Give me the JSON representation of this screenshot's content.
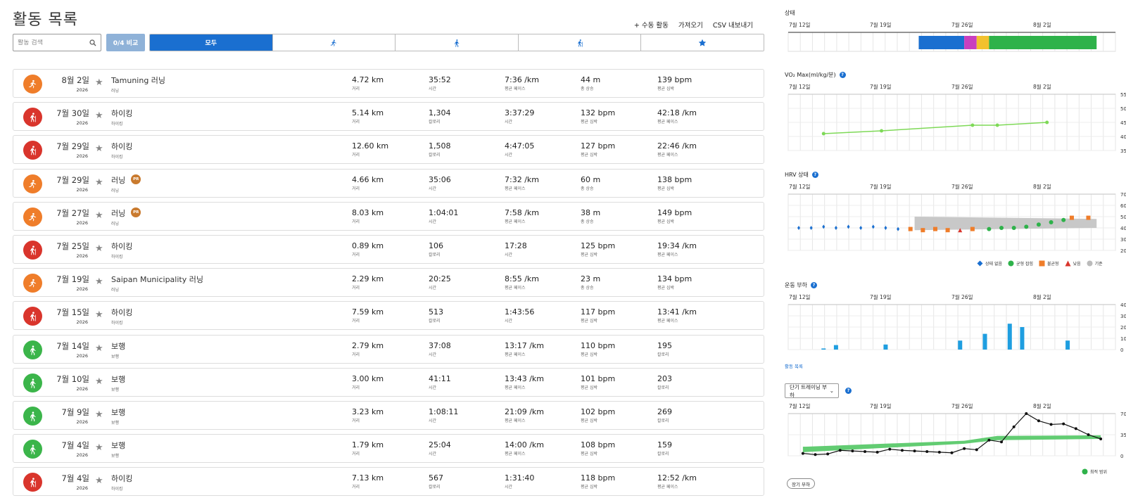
{
  "page": {
    "title": "활동 목록",
    "actions": [
      "+ 수동 활동",
      "가져오기",
      "CSV 내보내기"
    ],
    "search_placeholder": "활동 검색",
    "compare_label": "0/4 비교",
    "tabs": [
      {
        "label": "모두",
        "icon": "all",
        "active": true
      },
      {
        "label": "",
        "icon": "running-icon",
        "active": false
      },
      {
        "label": "",
        "icon": "walking-icon",
        "active": false
      },
      {
        "label": "",
        "icon": "hiking-icon",
        "active": false
      },
      {
        "label": "",
        "icon": "star-icon",
        "active": false
      }
    ]
  },
  "activities": [
    {
      "type": "running",
      "color": "#ef7d2a",
      "date": "8월 2일",
      "year": "2026",
      "name": "Tamuning 러닝",
      "sub": "러닝",
      "badge": false,
      "metrics": [
        {
          "v": "4.72 km",
          "l": "거리"
        },
        {
          "v": "35:52",
          "l": "시간"
        },
        {
          "v": "7:36 /km",
          "l": "평균 페이스"
        },
        {
          "v": "44 m",
          "l": "총 상승"
        },
        {
          "v": "139 bpm",
          "l": "평균 심박"
        }
      ]
    },
    {
      "type": "hiking",
      "color": "#d9352c",
      "date": "7월 30일",
      "year": "2026",
      "name": "하이킹",
      "sub": "하이킹",
      "badge": false,
      "metrics": [
        {
          "v": "5.14 km",
          "l": "거리"
        },
        {
          "v": "1,304",
          "l": "칼로리"
        },
        {
          "v": "3:37:29",
          "l": "시간"
        },
        {
          "v": "132 bpm",
          "l": "평균 심박"
        },
        {
          "v": "42:18 /km",
          "l": "평균 페이스"
        }
      ]
    },
    {
      "type": "hiking",
      "color": "#d9352c",
      "date": "7월 29일",
      "year": "2026",
      "name": "하이킹",
      "sub": "하이킹",
      "badge": false,
      "metrics": [
        {
          "v": "12.60 km",
          "l": "거리"
        },
        {
          "v": "1,508",
          "l": "칼로리"
        },
        {
          "v": "4:47:05",
          "l": "시간"
        },
        {
          "v": "127 bpm",
          "l": "평균 심박"
        },
        {
          "v": "22:46 /km",
          "l": "평균 페이스"
        }
      ]
    },
    {
      "type": "running",
      "color": "#ef7d2a",
      "date": "7월 29일",
      "year": "2026",
      "name": "러닝",
      "sub": "러닝",
      "badge": true,
      "metrics": [
        {
          "v": "4.66 km",
          "l": "거리"
        },
        {
          "v": "35:06",
          "l": "시간"
        },
        {
          "v": "7:32 /km",
          "l": "평균 페이스"
        },
        {
          "v": "60 m",
          "l": "총 상승"
        },
        {
          "v": "138 bpm",
          "l": "평균 심박"
        }
      ]
    },
    {
      "type": "running",
      "color": "#ef7d2a",
      "date": "7월 27일",
      "year": "2026",
      "name": "러닝",
      "sub": "러닝",
      "badge": true,
      "metrics": [
        {
          "v": "8.03 km",
          "l": "거리"
        },
        {
          "v": "1:04:01",
          "l": "시간"
        },
        {
          "v": "7:58 /km",
          "l": "평균 페이스"
        },
        {
          "v": "38 m",
          "l": "총 상승"
        },
        {
          "v": "149 bpm",
          "l": "평균 심박"
        }
      ]
    },
    {
      "type": "hiking",
      "color": "#d9352c",
      "date": "7월 25일",
      "year": "2026",
      "name": "하이킹",
      "sub": "하이킹",
      "badge": false,
      "metrics": [
        {
          "v": "0.89 km",
          "l": "거리"
        },
        {
          "v": "106",
          "l": "칼로리"
        },
        {
          "v": "17:28",
          "l": "시간"
        },
        {
          "v": "125 bpm",
          "l": "평균 심박"
        },
        {
          "v": "19:34 /km",
          "l": "평균 페이스"
        }
      ]
    },
    {
      "type": "running",
      "color": "#ef7d2a",
      "date": "7월 19일",
      "year": "2026",
      "name": "Saipan Municipality 러닝",
      "sub": "러닝",
      "badge": false,
      "metrics": [
        {
          "v": "2.29 km",
          "l": "거리"
        },
        {
          "v": "20:25",
          "l": "시간"
        },
        {
          "v": "8:55 /km",
          "l": "평균 페이스"
        },
        {
          "v": "23 m",
          "l": "총 상승"
        },
        {
          "v": "134 bpm",
          "l": "평균 심박"
        }
      ]
    },
    {
      "type": "hiking",
      "color": "#d9352c",
      "date": "7월 15일",
      "year": "2026",
      "name": "하이킹",
      "sub": "하이킹",
      "badge": false,
      "metrics": [
        {
          "v": "7.59 km",
          "l": "거리"
        },
        {
          "v": "513",
          "l": "칼로리"
        },
        {
          "v": "1:43:56",
          "l": "시간"
        },
        {
          "v": "117 bpm",
          "l": "평균 심박"
        },
        {
          "v": "13:41 /km",
          "l": "평균 페이스"
        }
      ]
    },
    {
      "type": "walking",
      "color": "#3bb54a",
      "date": "7월 14일",
      "year": "2026",
      "name": "보행",
      "sub": "보행",
      "badge": false,
      "metrics": [
        {
          "v": "2.79 km",
          "l": "거리"
        },
        {
          "v": "37:08",
          "l": "시간"
        },
        {
          "v": "13:17 /km",
          "l": "평균 페이스"
        },
        {
          "v": "110 bpm",
          "l": "평균 심박"
        },
        {
          "v": "195",
          "l": "칼로리"
        }
      ]
    },
    {
      "type": "walking",
      "color": "#3bb54a",
      "date": "7월 10일",
      "year": "2026",
      "name": "보행",
      "sub": "보행",
      "badge": false,
      "metrics": [
        {
          "v": "3.00 km",
          "l": "거리"
        },
        {
          "v": "41:11",
          "l": "시간"
        },
        {
          "v": "13:43 /km",
          "l": "평균 페이스"
        },
        {
          "v": "101 bpm",
          "l": "평균 심박"
        },
        {
          "v": "203",
          "l": "칼로리"
        }
      ]
    },
    {
      "type": "walking",
      "color": "#3bb54a",
      "date": "7월 9일",
      "year": "2026",
      "name": "보행",
      "sub": "보행",
      "badge": false,
      "metrics": [
        {
          "v": "3.23 km",
          "l": "거리"
        },
        {
          "v": "1:08:11",
          "l": "시간"
        },
        {
          "v": "21:09 /km",
          "l": "평균 페이스"
        },
        {
          "v": "102 bpm",
          "l": "평균 심박"
        },
        {
          "v": "269",
          "l": "칼로리"
        }
      ]
    },
    {
      "type": "walking",
      "color": "#3bb54a",
      "date": "7월 4일",
      "year": "2026",
      "name": "보행",
      "sub": "보행",
      "badge": false,
      "metrics": [
        {
          "v": "1.79 km",
          "l": "거리"
        },
        {
          "v": "25:04",
          "l": "시간"
        },
        {
          "v": "14:00 /km",
          "l": "평균 페이스"
        },
        {
          "v": "108 bpm",
          "l": "평균 심박"
        },
        {
          "v": "159",
          "l": "칼로리"
        }
      ]
    },
    {
      "type": "hiking",
      "color": "#d9352c",
      "date": "7월 4일",
      "year": "2026",
      "name": "하이킹",
      "sub": "하이킹",
      "badge": false,
      "metrics": [
        {
          "v": "7.13 km",
          "l": "거리"
        },
        {
          "v": "567",
          "l": "칼로리"
        },
        {
          "v": "1:31:40",
          "l": "시간"
        },
        {
          "v": "118 bpm",
          "l": "평균 심박"
        },
        {
          "v": "12:52 /km",
          "l": "평균 페이스"
        }
      ]
    }
  ],
  "right": {
    "date_labels": [
      "7월 12일",
      "7월 19일",
      "7월 26일",
      "8월 2일"
    ],
    "status": {
      "title": "상태",
      "segments": [
        {
          "from": 14.5,
          "to": 20,
          "color": "#1a6fd0"
        },
        {
          "from": 20,
          "to": 21.5,
          "color": "#c93fbf"
        },
        {
          "from": 21.5,
          "to": 23,
          "color": "#f2c12e"
        },
        {
          "from": 23,
          "to": 36,
          "color": "#2eb24a"
        }
      ]
    },
    "vo2": {
      "title": "VO₂ Max(ml/kg/분)",
      "yticks": [
        55,
        50,
        45,
        40,
        35
      ],
      "ylim": [
        35,
        55
      ],
      "points": [
        [
          3,
          41
        ],
        [
          10,
          42
        ],
        [
          21,
          44
        ],
        [
          24,
          44
        ],
        [
          30,
          45
        ]
      ],
      "color": "#7ed957"
    },
    "hrv": {
      "title": "HRV 상태",
      "yticks": [
        70,
        60,
        50,
        40,
        30,
        20
      ],
      "ylim": [
        20,
        70
      ],
      "band": {
        "from": 14,
        "to": 36,
        "low": [
          38,
          40
        ],
        "high": [
          50,
          48
        ]
      },
      "none": [
        [
          0,
          40
        ],
        [
          1.5,
          40
        ],
        [
          3,
          41
        ],
        [
          4.5,
          40
        ],
        [
          6,
          41
        ],
        [
          7.5,
          40
        ],
        [
          9,
          41
        ],
        [
          10.5,
          40
        ],
        [
          12,
          39
        ]
      ],
      "unbalanced": [
        [
          13.5,
          39
        ],
        [
          15,
          38
        ],
        [
          16.5,
          39
        ],
        [
          18,
          38
        ],
        [
          21,
          39
        ],
        [
          33,
          49
        ],
        [
          35,
          49
        ]
      ],
      "low": [
        [
          19.5,
          38
        ]
      ],
      "balanced": [
        [
          23,
          39
        ],
        [
          24.5,
          40
        ],
        [
          26,
          40
        ],
        [
          27.5,
          41
        ],
        [
          29,
          43
        ],
        [
          30.5,
          45
        ],
        [
          32,
          47
        ]
      ],
      "legend": [
        "상태 없음",
        "균형 잡힘",
        "불균형",
        "낮음",
        "기준"
      ]
    },
    "load": {
      "title": "운동 부하",
      "yticks": [
        400,
        300,
        200,
        100,
        0
      ],
      "ylim": [
        0,
        400
      ],
      "bars": [
        [
          3,
          10
        ],
        [
          4.5,
          40
        ],
        [
          10.5,
          45
        ],
        [
          19.5,
          80
        ],
        [
          22.5,
          140
        ],
        [
          25.5,
          230
        ],
        [
          27,
          200
        ],
        [
          32.5,
          80
        ]
      ],
      "link": "활동 목록"
    },
    "acute": {
      "dropdown": "단기 트레이닝 부하",
      "yticks": [
        700,
        350,
        0
      ],
      "ylim": [
        0,
        700
      ],
      "points": [
        [
          0.5,
          40
        ],
        [
          2,
          20
        ],
        [
          3.5,
          30
        ],
        [
          5,
          90
        ],
        [
          6.5,
          80
        ],
        [
          8,
          70
        ],
        [
          9.5,
          60
        ],
        [
          11,
          110
        ],
        [
          12.5,
          90
        ],
        [
          14,
          80
        ],
        [
          15.5,
          70
        ],
        [
          17,
          60
        ],
        [
          18.5,
          50
        ],
        [
          20,
          120
        ],
        [
          21.5,
          100
        ],
        [
          23,
          260
        ],
        [
          24.5,
          230
        ],
        [
          26,
          480
        ],
        [
          27.5,
          700
        ],
        [
          29,
          580
        ],
        [
          30.5,
          520
        ],
        [
          32,
          530
        ],
        [
          33.5,
          450
        ],
        [
          35,
          350
        ],
        [
          36.5,
          280
        ]
      ],
      "band_low": [
        [
          0.5,
          60
        ],
        [
          20,
          200
        ],
        [
          24,
          260
        ],
        [
          36.5,
          280
        ]
      ],
      "band_high": [
        [
          0.5,
          150
        ],
        [
          20,
          250
        ],
        [
          24,
          330
        ],
        [
          36.5,
          340
        ]
      ],
      "legend": "최적 범위",
      "button": "장기 부하"
    }
  }
}
